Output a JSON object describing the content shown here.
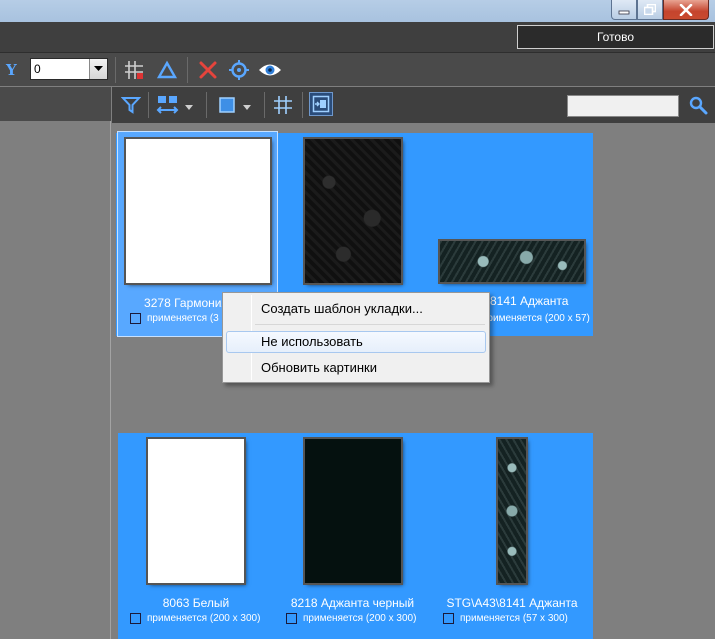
{
  "header": {
    "ready_label": "Готово"
  },
  "toolbar1": {
    "combo_value": "0"
  },
  "toolbar2": {
    "search_placeholder": ""
  },
  "tiles": [
    {
      "name": "3278 Гармония",
      "usage": "применяется (3"
    },
    {
      "name": "",
      "usage": ""
    },
    {
      "name": "2\\8141 Аджанта",
      "usage": "применяется (200 x 57)"
    },
    {
      "name": "8063 Белый",
      "usage": "применяется (200 x 300)"
    },
    {
      "name": "8218 Аджанта черный",
      "usage": "применяется (200 x 300)"
    },
    {
      "name": "STG\\A43\\8141 Аджанта",
      "usage": "применяется (57 x 300)"
    }
  ],
  "context_menu": {
    "items": [
      "Создать шаблон укладки...",
      "Не использовать",
      "Обновить картинки"
    ]
  },
  "colors": {
    "selection": "#3399ff",
    "panel": "#3f3f3f",
    "background": "#7f7f7f"
  }
}
